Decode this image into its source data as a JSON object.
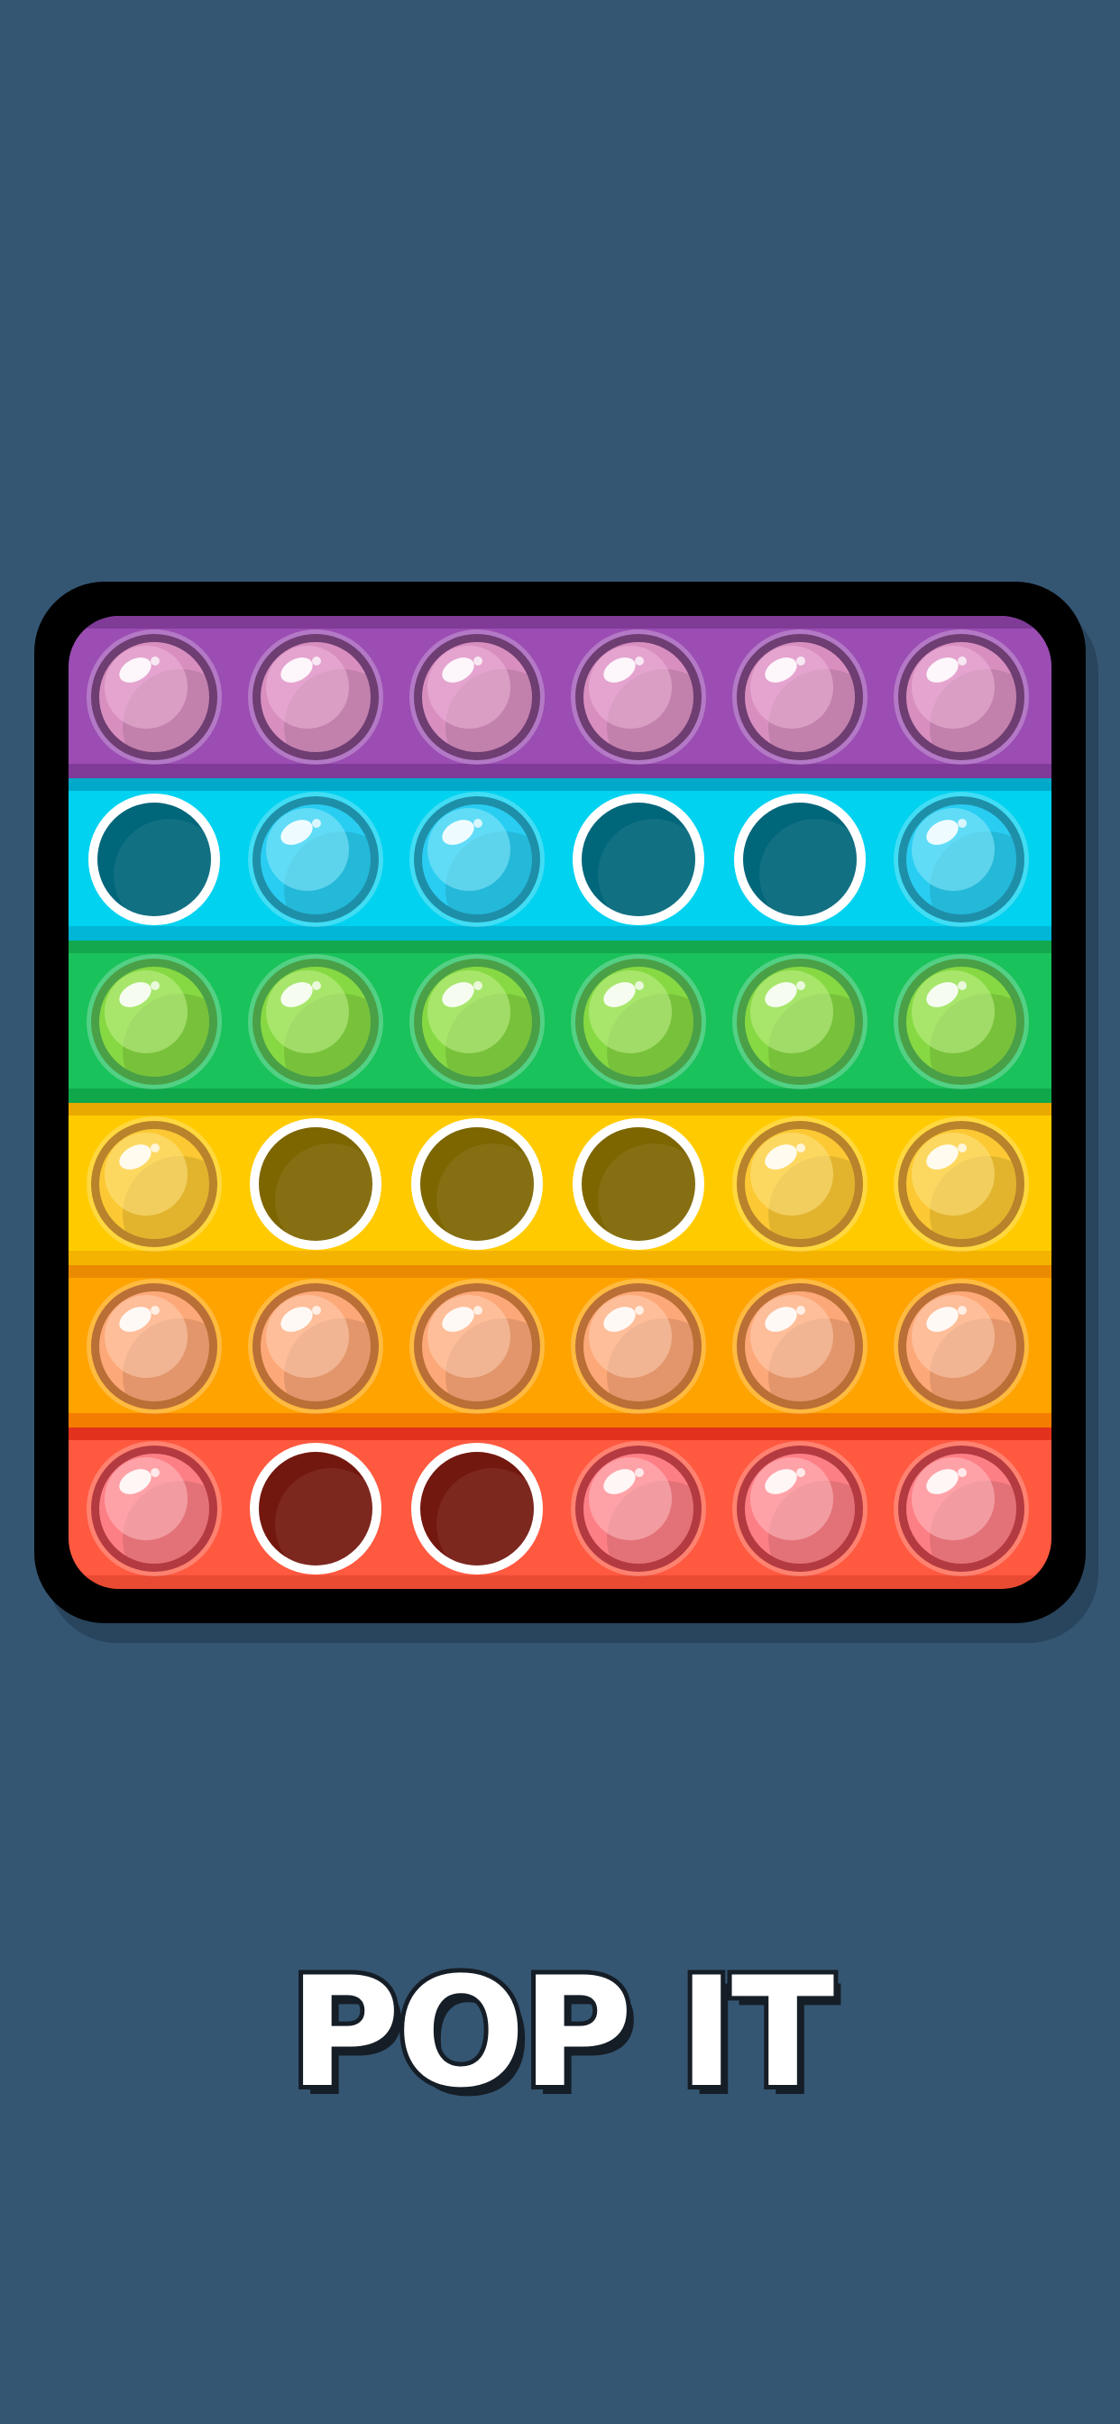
{
  "title": "POP IT",
  "colors": {
    "background": "#355672",
    "frame": "#000000"
  },
  "board": {
    "columns": 6,
    "rows": [
      {
        "name": "purple",
        "band": "#9b4db3",
        "band_top": "#7f3b96",
        "band_bottom": "#803a98",
        "bubble": "#d88fc0",
        "bubble_light": "#eeb6da",
        "ring": "#6e3d72",
        "hole": "#5a2b68",
        "pressed": [
          false,
          false,
          false,
          false,
          false,
          false
        ]
      },
      {
        "name": "cyan",
        "band": "#00d2f0",
        "band_top": "#00a9c9",
        "band_bottom": "#01b6d6",
        "bubble": "#29cdf2",
        "bubble_light": "#8ee9fb",
        "ring": "#1e8fa8",
        "hole": "#00667a",
        "pressed": [
          true,
          false,
          false,
          true,
          true,
          false
        ]
      },
      {
        "name": "green",
        "band": "#19c25b",
        "band_top": "#13a84d",
        "band_bottom": "#0fa74a",
        "bubble": "#86d942",
        "bubble_light": "#c2f08e",
        "ring": "#4aa046",
        "hole": "#1a6e2a",
        "pressed": [
          false,
          false,
          false,
          false,
          false,
          false
        ]
      },
      {
        "name": "yellow",
        "band": "#ffcb00",
        "band_top": "#e8a900",
        "band_bottom": "#f4b300",
        "bubble": "#fcc934",
        "bubble_light": "#fde487",
        "ring": "#b8832a",
        "hole": "#7d6500",
        "pressed": [
          false,
          true,
          true,
          true,
          false,
          false
        ]
      },
      {
        "name": "orange",
        "band": "#ffa300",
        "band_top": "#ea8a00",
        "band_bottom": "#f27d00",
        "bubble": "#fda878",
        "bubble_light": "#fed0b4",
        "ring": "#b96f35",
        "hole": "#7a4a00",
        "pressed": [
          false,
          false,
          false,
          false,
          false,
          false
        ]
      },
      {
        "name": "red",
        "band": "#ff5940",
        "band_top": "#e2311d",
        "band_bottom": "#e84a32",
        "bubble": "#fd7f86",
        "bubble_light": "#ffc0c3",
        "ring": "#b33a40",
        "hole": "#73180f",
        "pressed": [
          false,
          true,
          true,
          false,
          false,
          false
        ]
      }
    ]
  },
  "icons": {
    "bubble": "raised-bubble-icon",
    "popped": "popped-bubble-icon"
  }
}
